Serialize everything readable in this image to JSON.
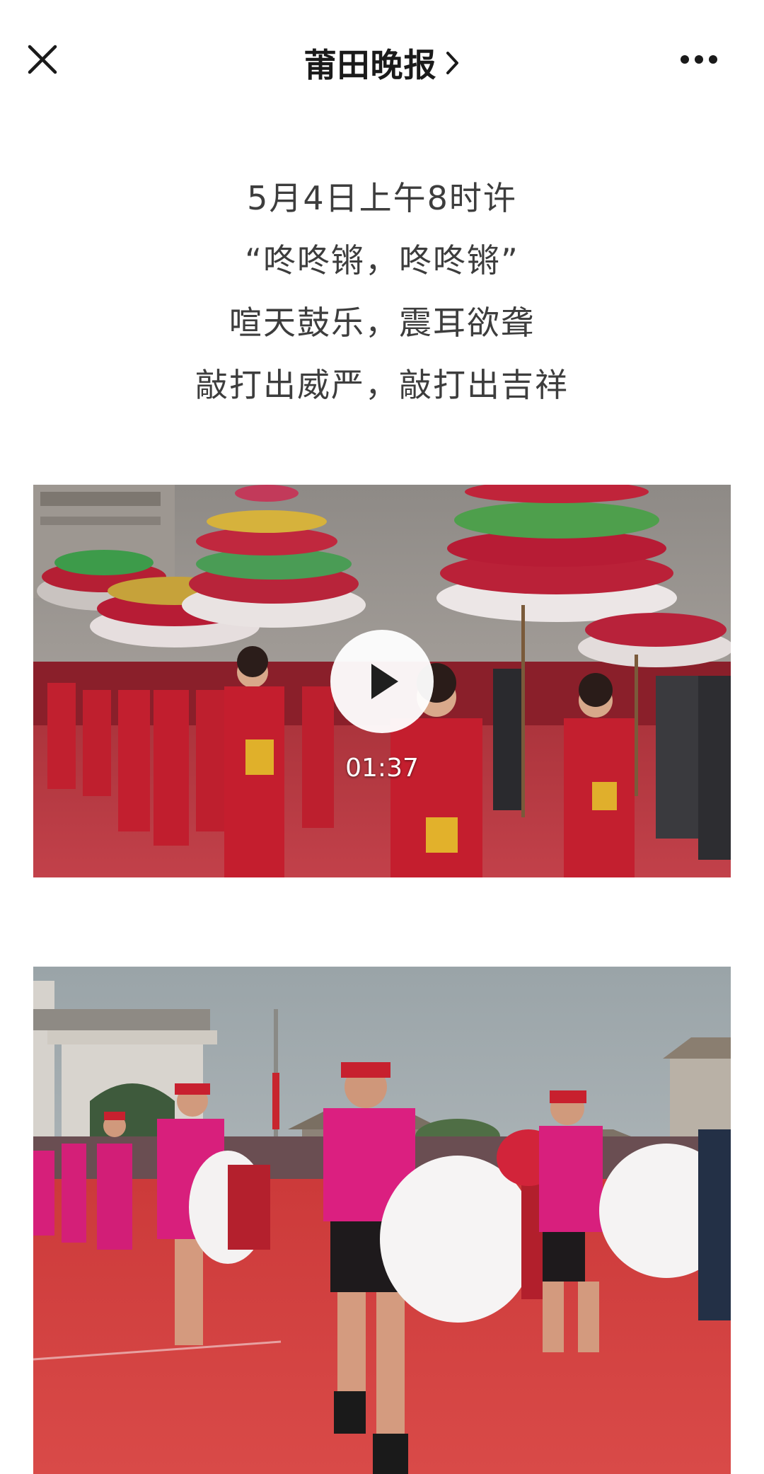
{
  "header": {
    "title": "莆田晚报",
    "close_icon": "close-icon",
    "chevron_icon": "chevron-right-icon",
    "more_icon": "more-dots-icon"
  },
  "intro": {
    "lines": [
      "5月4日上午8时许",
      "“咚咚锵，咚咚锵”",
      "喧天鼓乐，震耳欲聋",
      "敲打出威严，敲打出吉祥"
    ]
  },
  "video": {
    "duration": "01:37",
    "play_icon": "play-icon"
  },
  "colors": {
    "background": "#ffffff",
    "text": "#3d3d3d",
    "title": "#1a1a1a",
    "costume_red": "#c41e2e",
    "costume_pink": "#d61f7a",
    "ground_red": "#d33b3b"
  }
}
